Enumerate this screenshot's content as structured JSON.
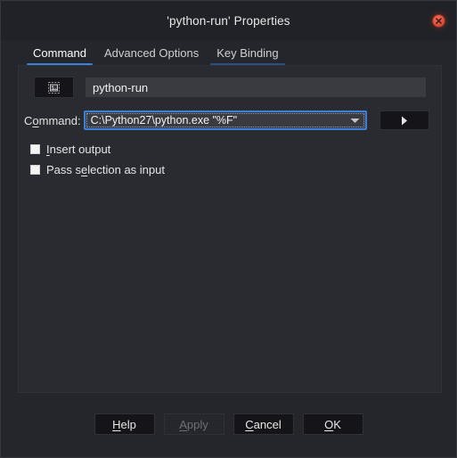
{
  "window": {
    "title": "'python-run' Properties",
    "close_icon": "close-icon"
  },
  "tabs": [
    {
      "label": "Command",
      "state": "active"
    },
    {
      "label": "Advanced Options",
      "state": "normal"
    },
    {
      "label": "Key Binding",
      "state": "hovered"
    }
  ],
  "command_tab": {
    "icon_button": {
      "icon": "image-placeholder-icon"
    },
    "name_field": {
      "value": "python-run",
      "placeholder": ""
    },
    "command": {
      "label_pre": "C",
      "label_mnemonic": "o",
      "label_post": "mmand:",
      "value": "C:\\Python27\\python.exe \"%F\"",
      "dropdown_icon": "chevron-down-icon",
      "browse_icon": "play-arrow-icon"
    },
    "checkboxes": [
      {
        "pre": "",
        "mnemonic": "I",
        "post": "nsert output",
        "checked": false
      },
      {
        "pre": "Pass s",
        "mnemonic": "e",
        "post": "lection as input",
        "checked": false
      }
    ]
  },
  "footer": {
    "buttons": [
      {
        "pre": "",
        "mnemonic": "H",
        "post": "elp",
        "enabled": true
      },
      {
        "pre": "",
        "mnemonic": "A",
        "post": "pply",
        "enabled": false
      },
      {
        "pre": "",
        "mnemonic": "C",
        "post": "ancel",
        "enabled": true
      },
      {
        "pre": "",
        "mnemonic": "O",
        "post": "K",
        "enabled": true
      }
    ]
  },
  "colors": {
    "window_bg": "#25262b",
    "titlebar_bg": "#212227",
    "panel_bg": "#2a2b30",
    "accent_blue": "#3f7fd6",
    "accent_blue_dim": "#2c4f84",
    "field_bg": "#3a3b40",
    "button_bg": "#151519",
    "close_red": "#e0503c"
  }
}
